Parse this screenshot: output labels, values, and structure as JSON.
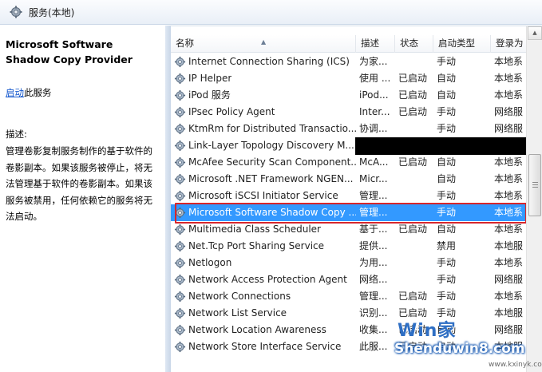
{
  "window": {
    "title": "服务(本地)"
  },
  "detail": {
    "service_name": "Microsoft Software Shadow Copy Provider",
    "start_link": "启动",
    "start_suffix": "此服务",
    "description_label": "描述:",
    "description": "管理卷影复制服务制作的基于软件的卷影副本。如果该服务被停止，将无法管理基于软件的卷影副本。如果该服务被禁用，任何依赖它的服务将无法启动。"
  },
  "columns": {
    "name": "名称",
    "description": "描述",
    "status": "状态",
    "startup": "启动类型",
    "logon": "登录为"
  },
  "services": [
    {
      "name": "Internet Connection Sharing (ICS)",
      "desc": "为家...",
      "status": "",
      "startup": "手动",
      "logon": "本地系"
    },
    {
      "name": "IP Helper",
      "desc": "使用 ...",
      "status": "已启动",
      "startup": "自动",
      "logon": "本地系"
    },
    {
      "name": "iPod 服务",
      "desc": "iPod...",
      "status": "已启动",
      "startup": "自动",
      "logon": "本地系"
    },
    {
      "name": "IPsec Policy Agent",
      "desc": "Inter...",
      "status": "已启动",
      "startup": "手动",
      "logon": "网络服"
    },
    {
      "name": "KtmRm for Distributed Transactio...",
      "desc": "协调...",
      "status": "",
      "startup": "手动",
      "logon": "网络服"
    },
    {
      "name": "Link-Layer Topology Discovery M...",
      "desc": "",
      "status": "",
      "startup": "",
      "logon": ""
    },
    {
      "name": "McAfee Security Scan Component...",
      "desc": "McA...",
      "status": "已启动",
      "startup": "自动",
      "logon": "本地系"
    },
    {
      "name": "Microsoft .NET Framework NGEN...",
      "desc": "Micr...",
      "status": "",
      "startup": "自动",
      "logon": "本地系"
    },
    {
      "name": "Microsoft iSCSI Initiator Service",
      "desc": "管理...",
      "status": "",
      "startup": "手动",
      "logon": "本地系"
    },
    {
      "name": "Microsoft Software Shadow Copy ...",
      "desc": "管理...",
      "status": "",
      "startup": "手动",
      "logon": "本地系"
    },
    {
      "name": "Multimedia Class Scheduler",
      "desc": "基于...",
      "status": "已启动",
      "startup": "自动",
      "logon": "本地系"
    },
    {
      "name": "Net.Tcp Port Sharing Service",
      "desc": "提供...",
      "status": "",
      "startup": "禁用",
      "logon": "本地服"
    },
    {
      "name": "Netlogon",
      "desc": "为用...",
      "status": "",
      "startup": "手动",
      "logon": "本地系"
    },
    {
      "name": "Network Access Protection Agent",
      "desc": "网络...",
      "status": "",
      "startup": "手动",
      "logon": "网络服"
    },
    {
      "name": "Network Connections",
      "desc": "管理...",
      "status": "已启动",
      "startup": "手动",
      "logon": "本地系"
    },
    {
      "name": "Network List Service",
      "desc": "识别...",
      "status": "已启动",
      "startup": "手动",
      "logon": "本地服"
    },
    {
      "name": "Network Location Awareness",
      "desc": "收集...",
      "status": "已启动",
      "startup": "自动",
      "logon": "网络服"
    },
    {
      "name": "Network Store Interface Service",
      "desc": "此服...",
      "status": "已启动",
      "startup": "自动",
      "logon": "本地服"
    }
  ],
  "selected_index": 9,
  "colors": {
    "selection": "#3399ff",
    "highlight_border": "#d7262c",
    "link": "#1155cc"
  },
  "icons": {
    "window": "services-gear-icon",
    "row": "service-gear-icon"
  },
  "watermark": {
    "line1": "Win家",
    "line2": "Shenduwin8.com",
    "line3": "www.kxinyk.com"
  }
}
